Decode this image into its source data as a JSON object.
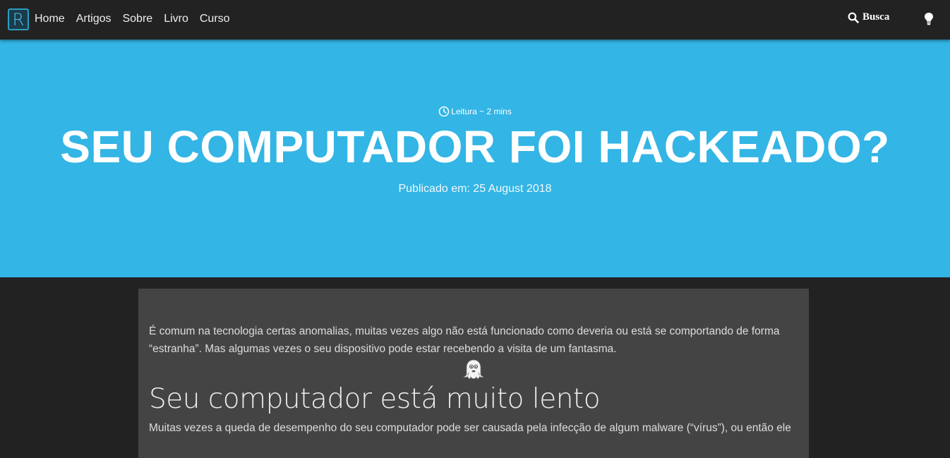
{
  "nav": {
    "logo_letter": "R",
    "links": [
      "Home",
      "Artigos",
      "Sobre",
      "Livro",
      "Curso"
    ],
    "search_label": "Busca"
  },
  "hero": {
    "reading_time": "Leitura ~ 2 mins",
    "title": "SEU COMPUTADOR FOI HACKEADO?",
    "published": "Publicado em: 25 August 2018",
    "background_color": "#33b5e5"
  },
  "article": {
    "intro": "É comum na tecnologia certas anomalias, muitas vezes algo não está funcionado como deveria ou está se comportando de forma “estranha”. Mas algumas vezes o seu dispositivo pode estar recebendo a visita de um fantasma.",
    "emoji_icon": "ghost-icon",
    "heading": "Seu computador está muito lento",
    "paragraph": "Muitas vezes a queda de desempenho do seu computador pode ser causada pela infecção de algum malware (“vírus”), ou então ele"
  },
  "colors": {
    "navbar": "#222222",
    "page_background": "#222222",
    "content_card": "#444444",
    "accent": "#33b5e5"
  }
}
